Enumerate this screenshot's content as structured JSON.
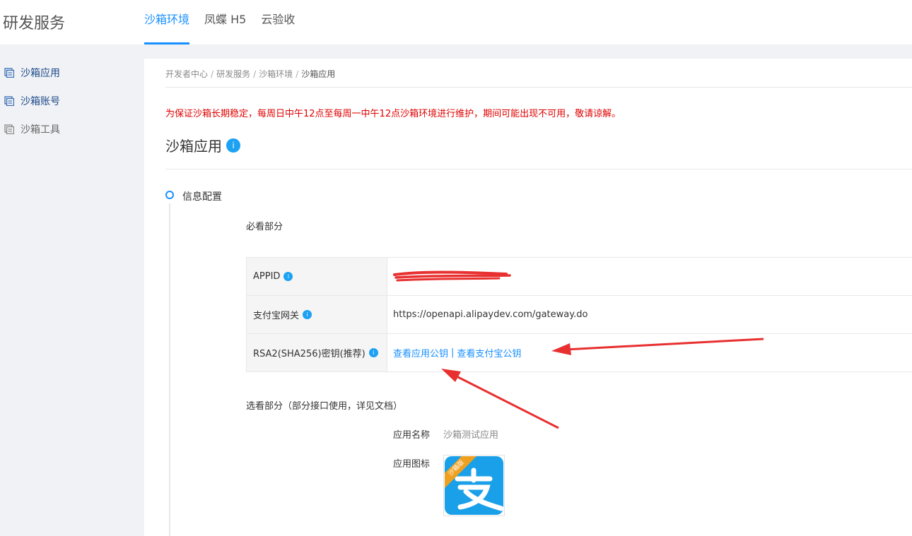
{
  "header": {
    "brand": "研发服务",
    "tabs": [
      {
        "label": "沙箱环境",
        "active": true
      },
      {
        "label": "凤蝶 H5",
        "active": false
      },
      {
        "label": "云验收",
        "active": false
      }
    ]
  },
  "sidebar": {
    "items": [
      {
        "label": "沙箱应用",
        "icon": "app-icon"
      },
      {
        "label": "沙箱账号",
        "icon": "account-icon"
      },
      {
        "label": "沙箱工具",
        "icon": "tool-icon"
      }
    ]
  },
  "breadcrumb": [
    "开发者中心",
    "研发服务",
    "沙箱环境",
    "沙箱应用"
  ],
  "breadcrumb_sep": "/",
  "notice": "为保证沙箱长期稳定，每周日中午12点至每周一中午12点沙箱环境进行维护，期间可能出现不可用，敬请谅解。",
  "page_title": "沙箱应用",
  "info_glyph": "i",
  "step": {
    "title": "信息配置"
  },
  "required_section": {
    "title": "必看部分",
    "rows": [
      {
        "key": "APPID",
        "value": ""
      },
      {
        "key": "支付宝网关",
        "value": "https://openapi.alipaydev.com/gateway.do"
      },
      {
        "key": "RSA2(SHA256)密钥(推荐)",
        "links": [
          "查看应用公钥",
          "查看支付宝公钥"
        ],
        "link_sep": "|"
      }
    ]
  },
  "optional_section": {
    "title": "选看部分（部分接口使用，详见文档）",
    "app_name_label": "应用名称",
    "app_name_value": "沙箱测试应用",
    "app_icon_label": "应用图标",
    "app_icon_badge": "沙箱版"
  },
  "colors": {
    "accent": "#1890ff",
    "notice": "#e00000",
    "annotation": "#e83030",
    "alipay_blue": "#1aa0e8"
  }
}
